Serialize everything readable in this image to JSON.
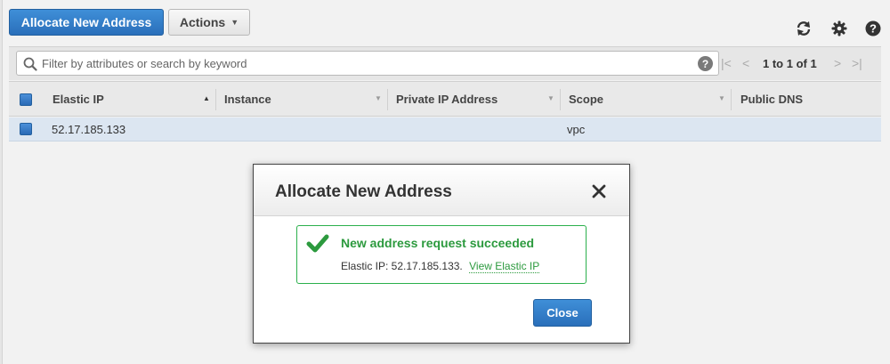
{
  "toolbar": {
    "allocate_label": "Allocate New Address",
    "actions_label": "Actions",
    "refresh_icon": "refresh-icon",
    "settings_icon": "gear-icon",
    "help_icon": "help-icon"
  },
  "search": {
    "placeholder": "Filter by attributes or search by keyword",
    "help_label": "?"
  },
  "pagination": {
    "label": "1 to 1 of 1"
  },
  "table": {
    "columns": [
      "Elastic IP",
      "Instance",
      "Private IP Address",
      "Scope",
      "Public DNS"
    ],
    "rows": [
      {
        "elastic_ip": "52.17.185.133",
        "instance": "",
        "private_ip": "",
        "scope": "vpc",
        "public_dns": ""
      }
    ]
  },
  "modal": {
    "title": "Allocate New Address",
    "success_title": "New address request succeeded",
    "success_body": "Elastic IP: 52.17.185.133.",
    "link_label": "View Elastic IP",
    "close_label": "Close"
  },
  "colors": {
    "primary": "#2a6fba",
    "success": "#2c9a3e",
    "row_selected": "#dce6f1"
  }
}
